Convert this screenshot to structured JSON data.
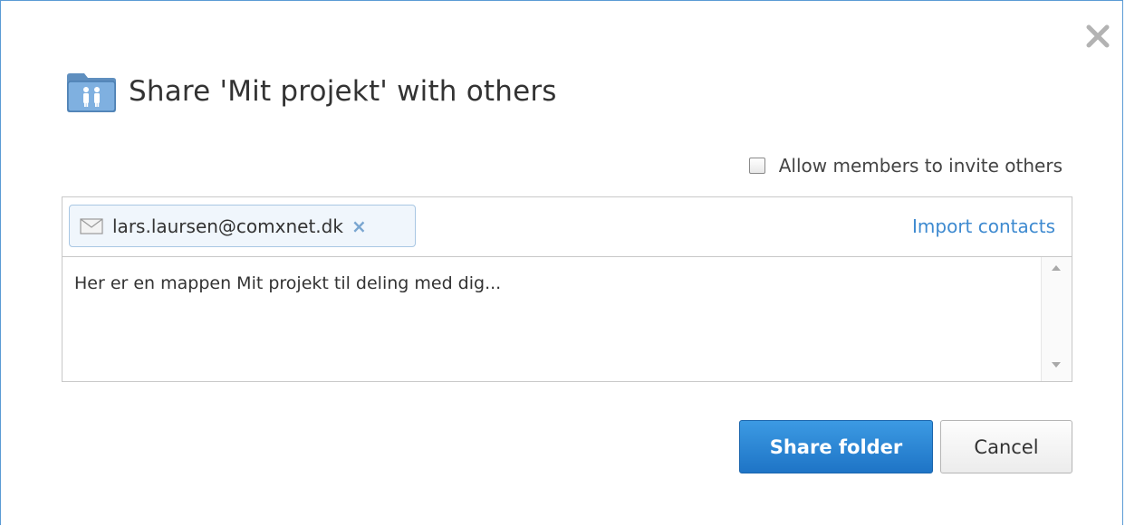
{
  "dialog": {
    "title": "Share 'Mit projekt' with others",
    "close_icon": "close-icon",
    "folder_icon": "shared-folder-icon"
  },
  "options": {
    "allow_invite_label": "Allow members to invite others",
    "allow_invite_checked": false
  },
  "recipients": {
    "items": [
      {
        "email": "lars.laursen@comxnet.dk",
        "icon": "envelope-icon",
        "remove_glyph": "×"
      }
    ],
    "import_label": "Import contacts"
  },
  "message": {
    "value": "Her er en mappen Mit projekt til deling med dig..."
  },
  "buttons": {
    "share_label": "Share folder",
    "cancel_label": "Cancel"
  },
  "colors": {
    "accent": "#1e74c6",
    "link": "#3e8ad0",
    "border": "#5b9bd5"
  }
}
